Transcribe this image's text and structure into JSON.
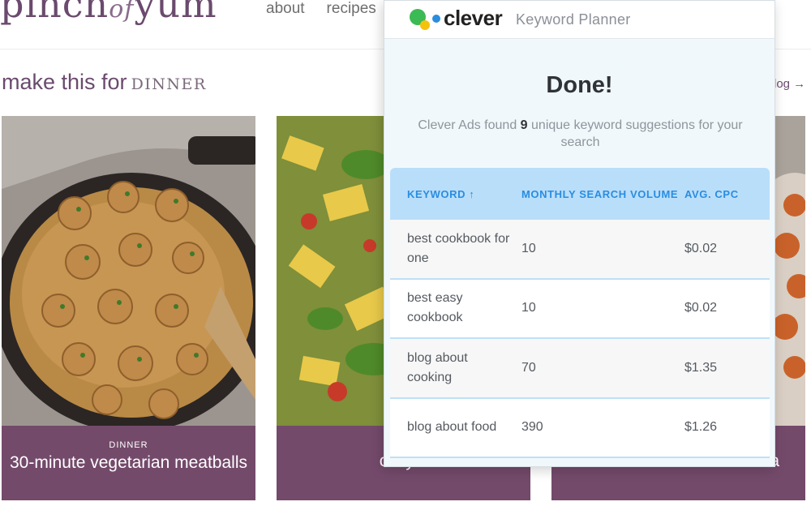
{
  "site": {
    "logo_main": "pinch",
    "logo_of": "of",
    "logo_end": "yum",
    "nav": [
      "about",
      "recipes"
    ],
    "section_title": "make this for",
    "section_caps": "DINNER",
    "blog_link": "log →",
    "cards": [
      {
        "category": "DINNER",
        "title": "30-minute vegetarian meatballs"
      },
      {
        "category": "",
        "title": "cozy v"
      },
      {
        "category": "",
        "title": "a"
      }
    ]
  },
  "popup": {
    "brand": "clever",
    "tool": "Keyword Planner",
    "done": "Done!",
    "found_pre": "Clever Ads found",
    "found_count": "9",
    "found_post": "unique keyword suggestions for your search",
    "headers": {
      "keyword": "KEYWORD ↑",
      "volume": "MONTHLY SEARCH VOLUME",
      "cpc": "AVG. CPC"
    },
    "rows": [
      {
        "keyword": "best cookbook for one",
        "volume": "10",
        "cpc": "$0.02"
      },
      {
        "keyword": "best easy cookbook",
        "volume": "10",
        "cpc": "$0.02"
      },
      {
        "keyword": "blog about cooking",
        "volume": "70",
        "cpc": "$1.35"
      },
      {
        "keyword": "blog about food",
        "volume": "390",
        "cpc": "$1.26"
      }
    ]
  },
  "colors": {
    "brand_purple": "#744a6b",
    "header_blue": "#b9defa",
    "header_text": "#2a8de0"
  }
}
